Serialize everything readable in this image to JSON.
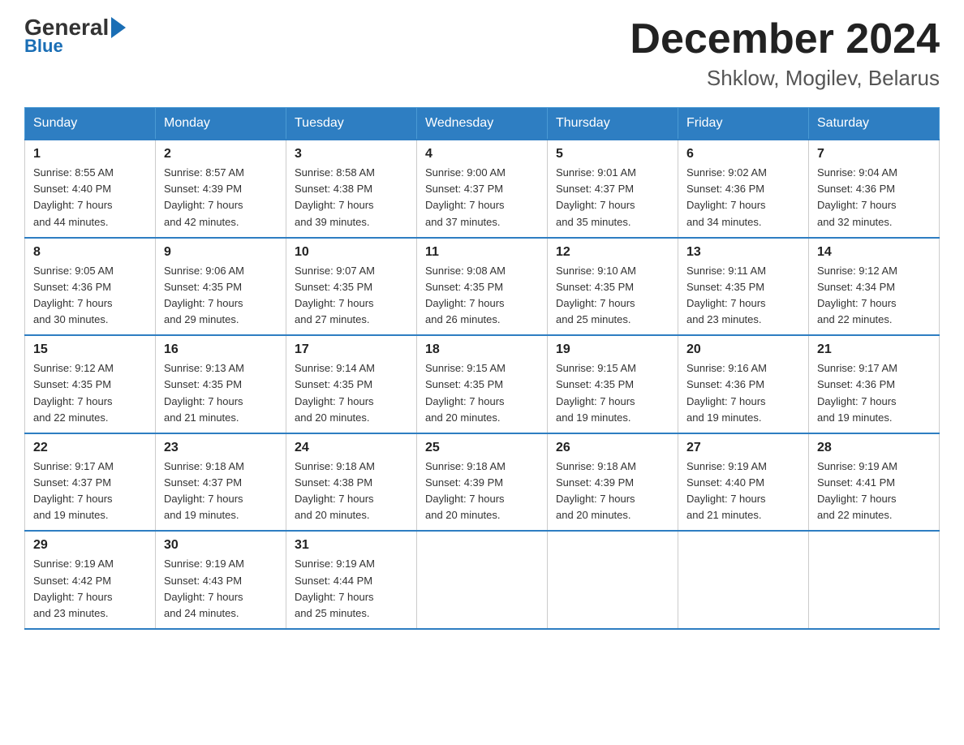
{
  "header": {
    "logo_general": "General",
    "logo_blue": "Blue",
    "month_title": "December 2024",
    "location": "Shklow, Mogilev, Belarus"
  },
  "weekdays": [
    "Sunday",
    "Monday",
    "Tuesday",
    "Wednesday",
    "Thursday",
    "Friday",
    "Saturday"
  ],
  "weeks": [
    [
      {
        "day": "1",
        "info": "Sunrise: 8:55 AM\nSunset: 4:40 PM\nDaylight: 7 hours\nand 44 minutes."
      },
      {
        "day": "2",
        "info": "Sunrise: 8:57 AM\nSunset: 4:39 PM\nDaylight: 7 hours\nand 42 minutes."
      },
      {
        "day": "3",
        "info": "Sunrise: 8:58 AM\nSunset: 4:38 PM\nDaylight: 7 hours\nand 39 minutes."
      },
      {
        "day": "4",
        "info": "Sunrise: 9:00 AM\nSunset: 4:37 PM\nDaylight: 7 hours\nand 37 minutes."
      },
      {
        "day": "5",
        "info": "Sunrise: 9:01 AM\nSunset: 4:37 PM\nDaylight: 7 hours\nand 35 minutes."
      },
      {
        "day": "6",
        "info": "Sunrise: 9:02 AM\nSunset: 4:36 PM\nDaylight: 7 hours\nand 34 minutes."
      },
      {
        "day": "7",
        "info": "Sunrise: 9:04 AM\nSunset: 4:36 PM\nDaylight: 7 hours\nand 32 minutes."
      }
    ],
    [
      {
        "day": "8",
        "info": "Sunrise: 9:05 AM\nSunset: 4:36 PM\nDaylight: 7 hours\nand 30 minutes."
      },
      {
        "day": "9",
        "info": "Sunrise: 9:06 AM\nSunset: 4:35 PM\nDaylight: 7 hours\nand 29 minutes."
      },
      {
        "day": "10",
        "info": "Sunrise: 9:07 AM\nSunset: 4:35 PM\nDaylight: 7 hours\nand 27 minutes."
      },
      {
        "day": "11",
        "info": "Sunrise: 9:08 AM\nSunset: 4:35 PM\nDaylight: 7 hours\nand 26 minutes."
      },
      {
        "day": "12",
        "info": "Sunrise: 9:10 AM\nSunset: 4:35 PM\nDaylight: 7 hours\nand 25 minutes."
      },
      {
        "day": "13",
        "info": "Sunrise: 9:11 AM\nSunset: 4:35 PM\nDaylight: 7 hours\nand 23 minutes."
      },
      {
        "day": "14",
        "info": "Sunrise: 9:12 AM\nSunset: 4:34 PM\nDaylight: 7 hours\nand 22 minutes."
      }
    ],
    [
      {
        "day": "15",
        "info": "Sunrise: 9:12 AM\nSunset: 4:35 PM\nDaylight: 7 hours\nand 22 minutes."
      },
      {
        "day": "16",
        "info": "Sunrise: 9:13 AM\nSunset: 4:35 PM\nDaylight: 7 hours\nand 21 minutes."
      },
      {
        "day": "17",
        "info": "Sunrise: 9:14 AM\nSunset: 4:35 PM\nDaylight: 7 hours\nand 20 minutes."
      },
      {
        "day": "18",
        "info": "Sunrise: 9:15 AM\nSunset: 4:35 PM\nDaylight: 7 hours\nand 20 minutes."
      },
      {
        "day": "19",
        "info": "Sunrise: 9:15 AM\nSunset: 4:35 PM\nDaylight: 7 hours\nand 19 minutes."
      },
      {
        "day": "20",
        "info": "Sunrise: 9:16 AM\nSunset: 4:36 PM\nDaylight: 7 hours\nand 19 minutes."
      },
      {
        "day": "21",
        "info": "Sunrise: 9:17 AM\nSunset: 4:36 PM\nDaylight: 7 hours\nand 19 minutes."
      }
    ],
    [
      {
        "day": "22",
        "info": "Sunrise: 9:17 AM\nSunset: 4:37 PM\nDaylight: 7 hours\nand 19 minutes."
      },
      {
        "day": "23",
        "info": "Sunrise: 9:18 AM\nSunset: 4:37 PM\nDaylight: 7 hours\nand 19 minutes."
      },
      {
        "day": "24",
        "info": "Sunrise: 9:18 AM\nSunset: 4:38 PM\nDaylight: 7 hours\nand 20 minutes."
      },
      {
        "day": "25",
        "info": "Sunrise: 9:18 AM\nSunset: 4:39 PM\nDaylight: 7 hours\nand 20 minutes."
      },
      {
        "day": "26",
        "info": "Sunrise: 9:18 AM\nSunset: 4:39 PM\nDaylight: 7 hours\nand 20 minutes."
      },
      {
        "day": "27",
        "info": "Sunrise: 9:19 AM\nSunset: 4:40 PM\nDaylight: 7 hours\nand 21 minutes."
      },
      {
        "day": "28",
        "info": "Sunrise: 9:19 AM\nSunset: 4:41 PM\nDaylight: 7 hours\nand 22 minutes."
      }
    ],
    [
      {
        "day": "29",
        "info": "Sunrise: 9:19 AM\nSunset: 4:42 PM\nDaylight: 7 hours\nand 23 minutes."
      },
      {
        "day": "30",
        "info": "Sunrise: 9:19 AM\nSunset: 4:43 PM\nDaylight: 7 hours\nand 24 minutes."
      },
      {
        "day": "31",
        "info": "Sunrise: 9:19 AM\nSunset: 4:44 PM\nDaylight: 7 hours\nand 25 minutes."
      },
      {
        "day": "",
        "info": ""
      },
      {
        "day": "",
        "info": ""
      },
      {
        "day": "",
        "info": ""
      },
      {
        "day": "",
        "info": ""
      }
    ]
  ]
}
